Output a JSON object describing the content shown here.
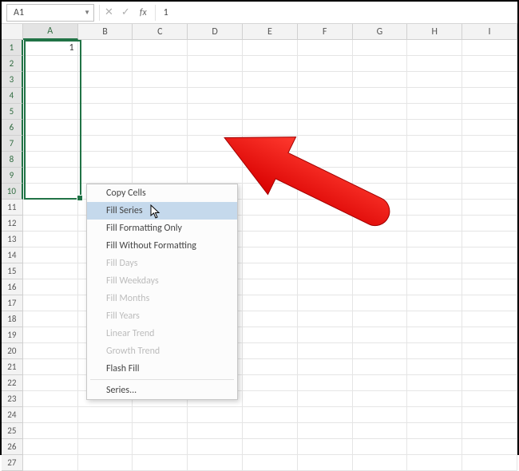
{
  "namebox": {
    "value": "A1"
  },
  "formula": {
    "value": "1"
  },
  "fx": {
    "cancel": "✕",
    "confirm": "✓",
    "label": "fx"
  },
  "columns": [
    "A",
    "B",
    "C",
    "D",
    "E",
    "F",
    "G",
    "H",
    "I"
  ],
  "activeColumn": "A",
  "rows": [
    "1",
    "2",
    "3",
    "4",
    "5",
    "6",
    "7",
    "8",
    "9",
    "10",
    "11",
    "12",
    "13",
    "14",
    "15",
    "16",
    "17",
    "18",
    "19",
    "20",
    "21",
    "22",
    "23",
    "24",
    "25",
    "26",
    "27"
  ],
  "activeRows": [
    "1",
    "2",
    "3",
    "4",
    "5",
    "6",
    "7",
    "8",
    "9",
    "10"
  ],
  "cell_A1": "1",
  "menu": {
    "copy_cells": "Copy Cells",
    "fill_series": "Fill Series",
    "fill_formatting_only": "Fill Formatting Only",
    "fill_without_formatting": "Fill Without Formatting",
    "fill_days": "Fill Days",
    "fill_weekdays": "Fill Weekdays",
    "fill_months": "Fill Months",
    "fill_years": "Fill Years",
    "linear_trend": "Linear Trend",
    "growth_trend": "Growth Trend",
    "flash_fill": "Flash Fill",
    "series": "Series..."
  }
}
